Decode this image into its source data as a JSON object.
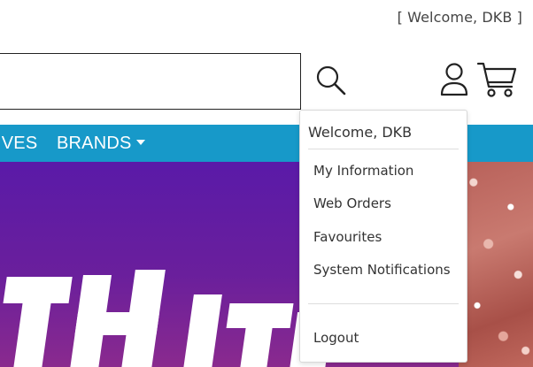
{
  "header": {
    "welcome_text": "[ Welcome, DKB ]",
    "search_value": ""
  },
  "icons": {
    "search": "search-icon",
    "user": "user-icon",
    "cart": "cart-icon"
  },
  "nav": {
    "items": [
      {
        "label": "IVES"
      },
      {
        "label": "BRANDS",
        "has_dropdown": true
      }
    ],
    "background_color": "#1799c9"
  },
  "hero": {
    "text_fragment": "ITH IT"
  },
  "account_menu": {
    "header": "Welcome, DKB",
    "items": [
      {
        "label": "My Information"
      },
      {
        "label": "Web Orders"
      },
      {
        "label": "Favourites"
      },
      {
        "label": "System Notifications"
      }
    ],
    "logout_label": "Logout"
  }
}
